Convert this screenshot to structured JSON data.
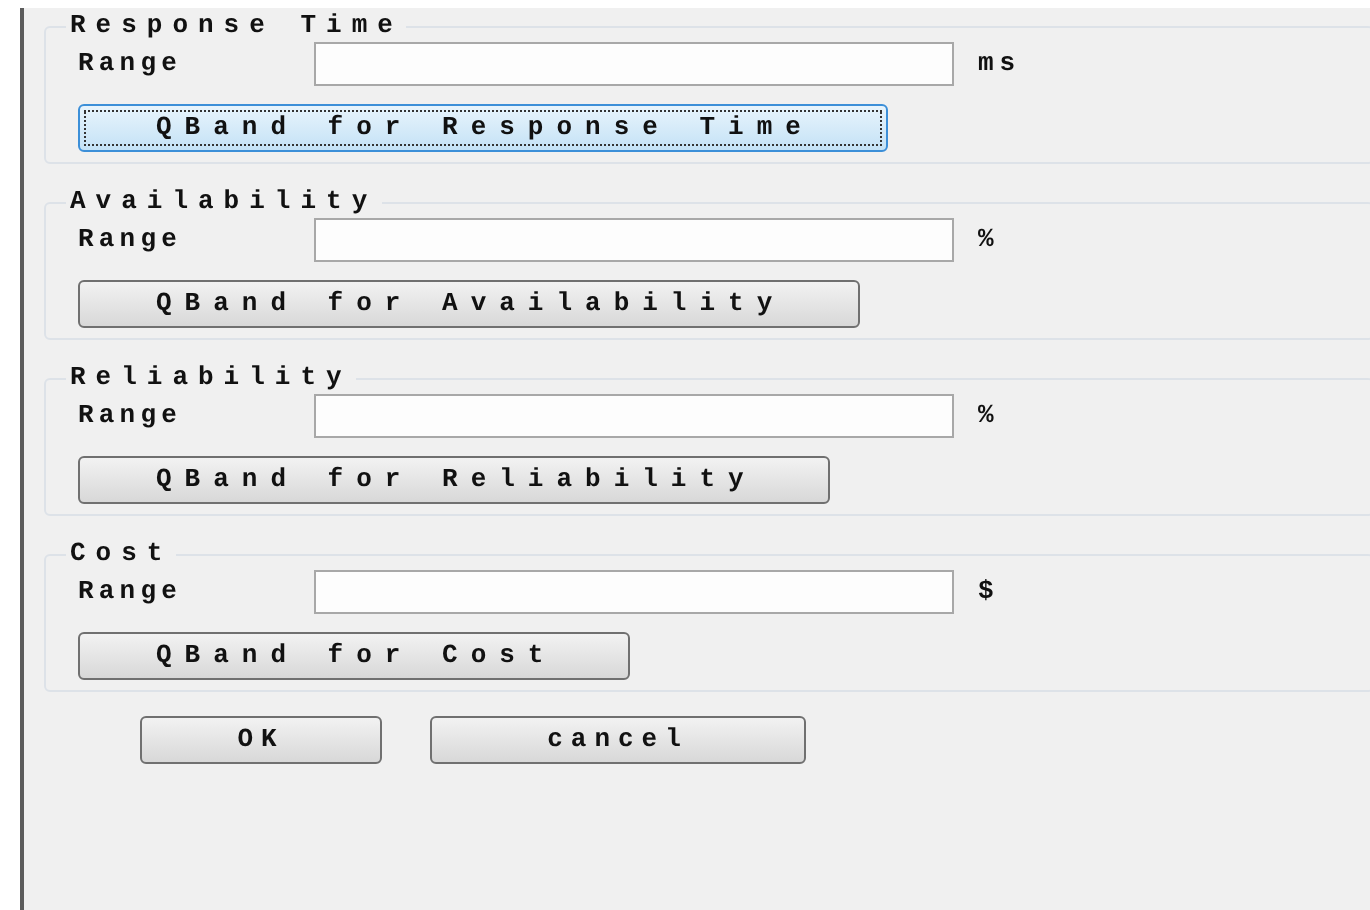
{
  "groups": [
    {
      "title": "Response Time",
      "range_label": "Range",
      "unit": "ms",
      "button": {
        "label": "QBand for Response Time",
        "focused": true
      }
    },
    {
      "title": "Availability",
      "range_label": "Range",
      "unit": "%",
      "button": {
        "label": "QBand for Availability",
        "focused": false
      }
    },
    {
      "title": "Reliability",
      "range_label": "Range",
      "unit": "%",
      "button": {
        "label": "QBand for Reliability",
        "focused": false
      }
    },
    {
      "title": "Cost",
      "range_label": "Range",
      "unit": "$",
      "button": {
        "label": "QBand for Cost",
        "focused": false
      }
    }
  ],
  "buttons": [
    {
      "label": "OK"
    },
    {
      "label": "cancel"
    }
  ]
}
